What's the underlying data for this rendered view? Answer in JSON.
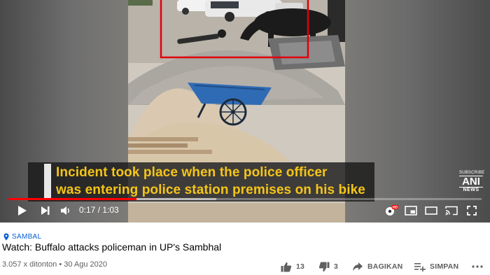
{
  "video": {
    "caption_line1": "Incident took place when the police officer",
    "caption_line2": "was entering police station premises on his bike",
    "watermark": {
      "subscribe": "SUBSCRIBE",
      "brand": "ANI",
      "news": "NEWS"
    },
    "progress_fraction": 0.27,
    "buffer_fraction": 0.44,
    "time_display": "0:17 / 1:03",
    "controls": {
      "play_icon": "play-icon",
      "next_icon": "next-icon",
      "volume_icon": "volume-icon",
      "settings_icon": "settings-hd-icon",
      "hd_badge": "HD",
      "miniplayer_icon": "miniplayer-icon",
      "theater_icon": "theater-icon",
      "cast_icon": "cast-icon",
      "fullscreen_icon": "fullscreen-icon"
    },
    "colors": {
      "caption_text": "#f5c518",
      "progress": "#ff0000",
      "highlight_box": "#e0000d"
    }
  },
  "info": {
    "channel": "SAMBAL",
    "title": "Watch: Buffalo attacks policeman in UP's Sambhal",
    "meta": "3.057 x ditonton • 30 Agu 2020",
    "actions": {
      "likes": "13",
      "dislikes": "3",
      "share": "BAGIKAN",
      "save": "SIMPAN"
    },
    "colors": {
      "channel": "#065fd4"
    }
  }
}
